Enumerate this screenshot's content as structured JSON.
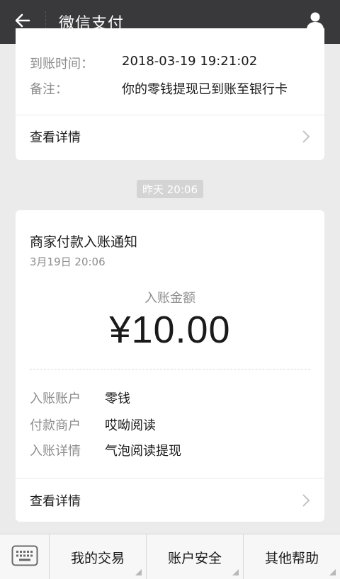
{
  "header": {
    "title": "微信支付"
  },
  "top_card": {
    "rows": [
      {
        "key": "到账时间：",
        "value": "2018-03-19 19:21:02"
      },
      {
        "key": "备注：",
        "value": "你的零钱提现已到账至银行卡"
      }
    ],
    "detail_label": "查看详情"
  },
  "time_badge": "昨天 20:06",
  "main_card": {
    "title": "商家付款入账通知",
    "date": "3月19日  20:06",
    "amount_label": "入账金额",
    "amount": "¥10.00",
    "rows": [
      {
        "key": "入账账户",
        "value": "零钱"
      },
      {
        "key": "付款商户",
        "value": "哎呦阅读"
      },
      {
        "key": "入账详情",
        "value": "气泡阅读提现"
      }
    ],
    "detail_label": "查看详情"
  },
  "bottom_bar": {
    "items": [
      "我的交易",
      "账户安全",
      "其他帮助"
    ]
  },
  "colors": {
    "header_bg": "#39393b",
    "page_bg": "#ebebeb",
    "muted_text": "#8c8c8c"
  },
  "icons": [
    "back-arrow-icon",
    "user-icon",
    "chevron-right-icon",
    "keyboard-icon"
  ]
}
